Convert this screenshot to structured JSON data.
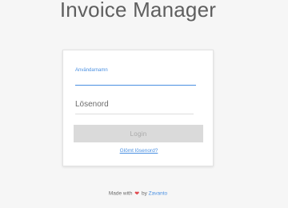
{
  "app": {
    "title": "Invoice Manager"
  },
  "login": {
    "username_label": "Användarnamn",
    "username_value": "",
    "password_placeholder": "Lösenord",
    "login_button": "Login",
    "forgot_link": "Glömt lösenord?"
  },
  "footer": {
    "made_with": "Made with",
    "by": "by",
    "brand": "Zavanto",
    "heart_icon": "heart-icon"
  },
  "colors": {
    "accent": "#4a90e2",
    "heart": "#e0474c",
    "button_bg": "#dadada",
    "background": "#f6f6f6"
  }
}
